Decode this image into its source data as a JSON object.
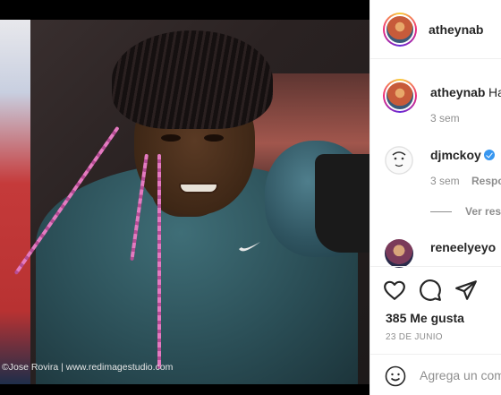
{
  "post": {
    "image_alt": "Boxer wearing blue glove and teal shirt with braided hair",
    "watermark": "©Jose Rovira | www.redimagestudio.com"
  },
  "header": {
    "username": "atheynab"
  },
  "comments": [
    {
      "username": "atheynab",
      "text": "Ha",
      "time": "3 sem",
      "verified": false
    },
    {
      "username": "djmckoy",
      "text": "",
      "time": "3 sem",
      "reply_label": "Respo",
      "verified": true
    },
    {
      "username": "reneelyeyo",
      "text": "",
      "verified": false
    }
  ],
  "view_replies": "Ver res",
  "actions": {
    "like_icon": "heart-icon",
    "comment_icon": "comment-icon",
    "share_icon": "paper-plane-icon"
  },
  "likes": "385 Me gusta",
  "date": "23 DE JUNIO",
  "add_comment": {
    "placeholder": "Agrega un com",
    "emoji_icon": "smiley-icon"
  },
  "colors": {
    "verified": "#3897f0",
    "text": "#262626",
    "muted": "#8e8e8e"
  }
}
